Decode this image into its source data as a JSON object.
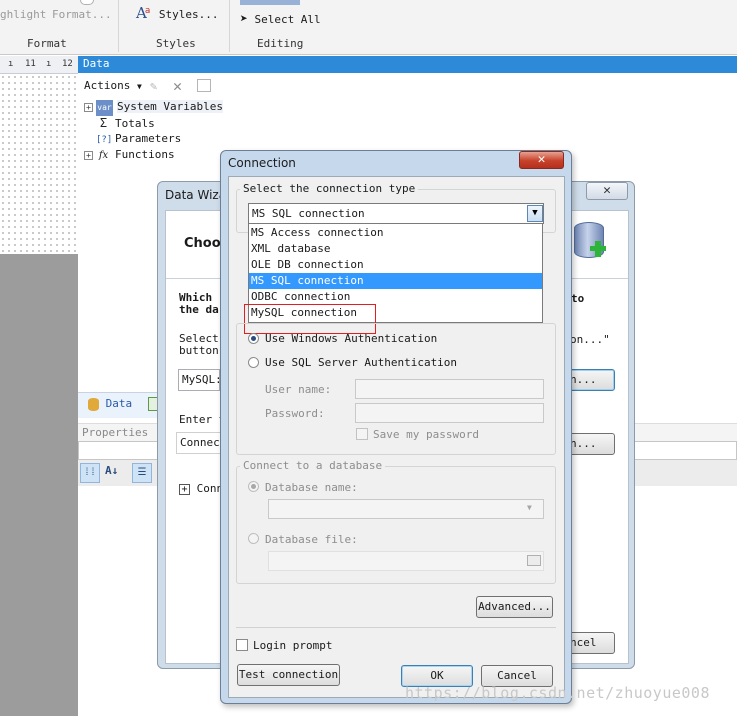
{
  "ribbon": {
    "highlight_label": "ghlight",
    "format_button_label": "Format...",
    "styles_button_label": "Styles...",
    "select_all_label": "Select All",
    "groups": [
      "Format",
      "Styles",
      "Editing"
    ]
  },
  "ruler": {
    "marks": [
      "11",
      "12"
    ]
  },
  "data_panel": {
    "title": "Data",
    "actions_label": "Actions",
    "tree": [
      {
        "icon": "var",
        "label": "System Variables"
      },
      {
        "icon": "Σ",
        "label": "Totals"
      },
      {
        "icon": "[?]",
        "label": "Parameters"
      },
      {
        "icon": "fx",
        "label": "Functions"
      }
    ],
    "tab_data": "Data",
    "properties_label": "Properties"
  },
  "wizard": {
    "title": "Data Wiza",
    "heading": "Choo",
    "which_line1": "Which",
    "which_line2": "the da",
    "to_fragment": "to",
    "select_line1": "Select",
    "select_line2": "button",
    "quote_fragment": "on...\"",
    "mysql_field": "MySQL:",
    "build_button": "n...",
    "enter_label": "Enter t",
    "connect_field": "Connect",
    "build2_button": "n...",
    "conn_node": "Conn",
    "cancel_button": "ncel",
    "se_fragment": "Se"
  },
  "connection_dialog": {
    "title": "Connection",
    "type_group": "Select the connection type",
    "selected_type": "MS SQL connection",
    "types": [
      "MS Access connection",
      "XML database",
      "OLE DB connection",
      "MS SQL connection",
      "ODBC connection",
      "MySQL connection"
    ],
    "highlighted_type_index": 3,
    "auth_windows": "Use Windows Authentication",
    "auth_sql": "Use SQL Server Authentication",
    "user_name_label": "User name:",
    "password_label": "Password:",
    "save_password_label": "Save my password",
    "connect_group": "Connect to a database",
    "database_name_label": "Database name:",
    "database_file_label": "Database file:",
    "advanced_button": "Advanced...",
    "login_prompt_label": "Login prompt",
    "test_button": "Test connection",
    "ok_button": "OK",
    "cancel_button": "Cancel"
  },
  "watermark": "https://blog.csdn.net/zhuoyue008"
}
